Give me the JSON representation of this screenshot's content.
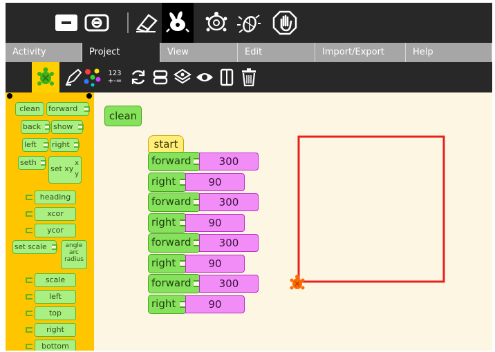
{
  "tabs": [
    {
      "label": "Activity"
    },
    {
      "label": "Project"
    },
    {
      "label": "View"
    },
    {
      "label": "Edit"
    },
    {
      "label": "Import/Export"
    },
    {
      "label": "Help"
    }
  ],
  "active_tab": "Project",
  "toolbar_icons": [
    "stop-fullscreen-icon",
    "camera-icon",
    "eraser-icon",
    "run-fast-icon",
    "run-slow-icon",
    "debug-bug-icon",
    "stop-hand-icon"
  ],
  "project_icons": [
    "turtle-palette-icon",
    "pen-palette-icon",
    "colors-palette-icon",
    "numbers-palette-icon",
    "flow-palette-icon",
    "blocks-palette-icon",
    "extras-palette-icon",
    "sensors-palette-icon",
    "media-palette-icon",
    "trash-icon"
  ],
  "numbers_icon_text": {
    "top": "123",
    "bottom": "+-="
  },
  "palette": {
    "clean": "clean",
    "forward": "forward",
    "back": "back",
    "show": "show",
    "left": "left",
    "right": "right",
    "seth": "seth",
    "setxy": "set xy",
    "setxy_x": "x",
    "setxy_y": "y",
    "heading": "heading",
    "xcor": "xcor",
    "ycor": "ycor",
    "setscale": "set scale",
    "arc_angle": "angle",
    "arc_arc": "arc",
    "arc_radius": "radius",
    "scale": "scale",
    "left_edge": "left",
    "top": "top",
    "right_edge": "right",
    "bottom": "bottom"
  },
  "canvas": {
    "clean_label": "clean",
    "start_label": "start",
    "program": [
      {
        "cmd": "forward",
        "value": "300"
      },
      {
        "cmd": "right",
        "value": "90"
      },
      {
        "cmd": "forward",
        "value": "300"
      },
      {
        "cmd": "right",
        "value": "90"
      },
      {
        "cmd": "forward",
        "value": "300"
      },
      {
        "cmd": "right",
        "value": "90"
      },
      {
        "cmd": "forward",
        "value": "300"
      },
      {
        "cmd": "right",
        "value": "90"
      }
    ]
  },
  "colors": {
    "pen": "#e8201c",
    "turtle": "#ff6a00",
    "canvas_bg": "#fdf6e3",
    "palette_bg": "#ffc600",
    "toolbar_bg": "#282828"
  }
}
